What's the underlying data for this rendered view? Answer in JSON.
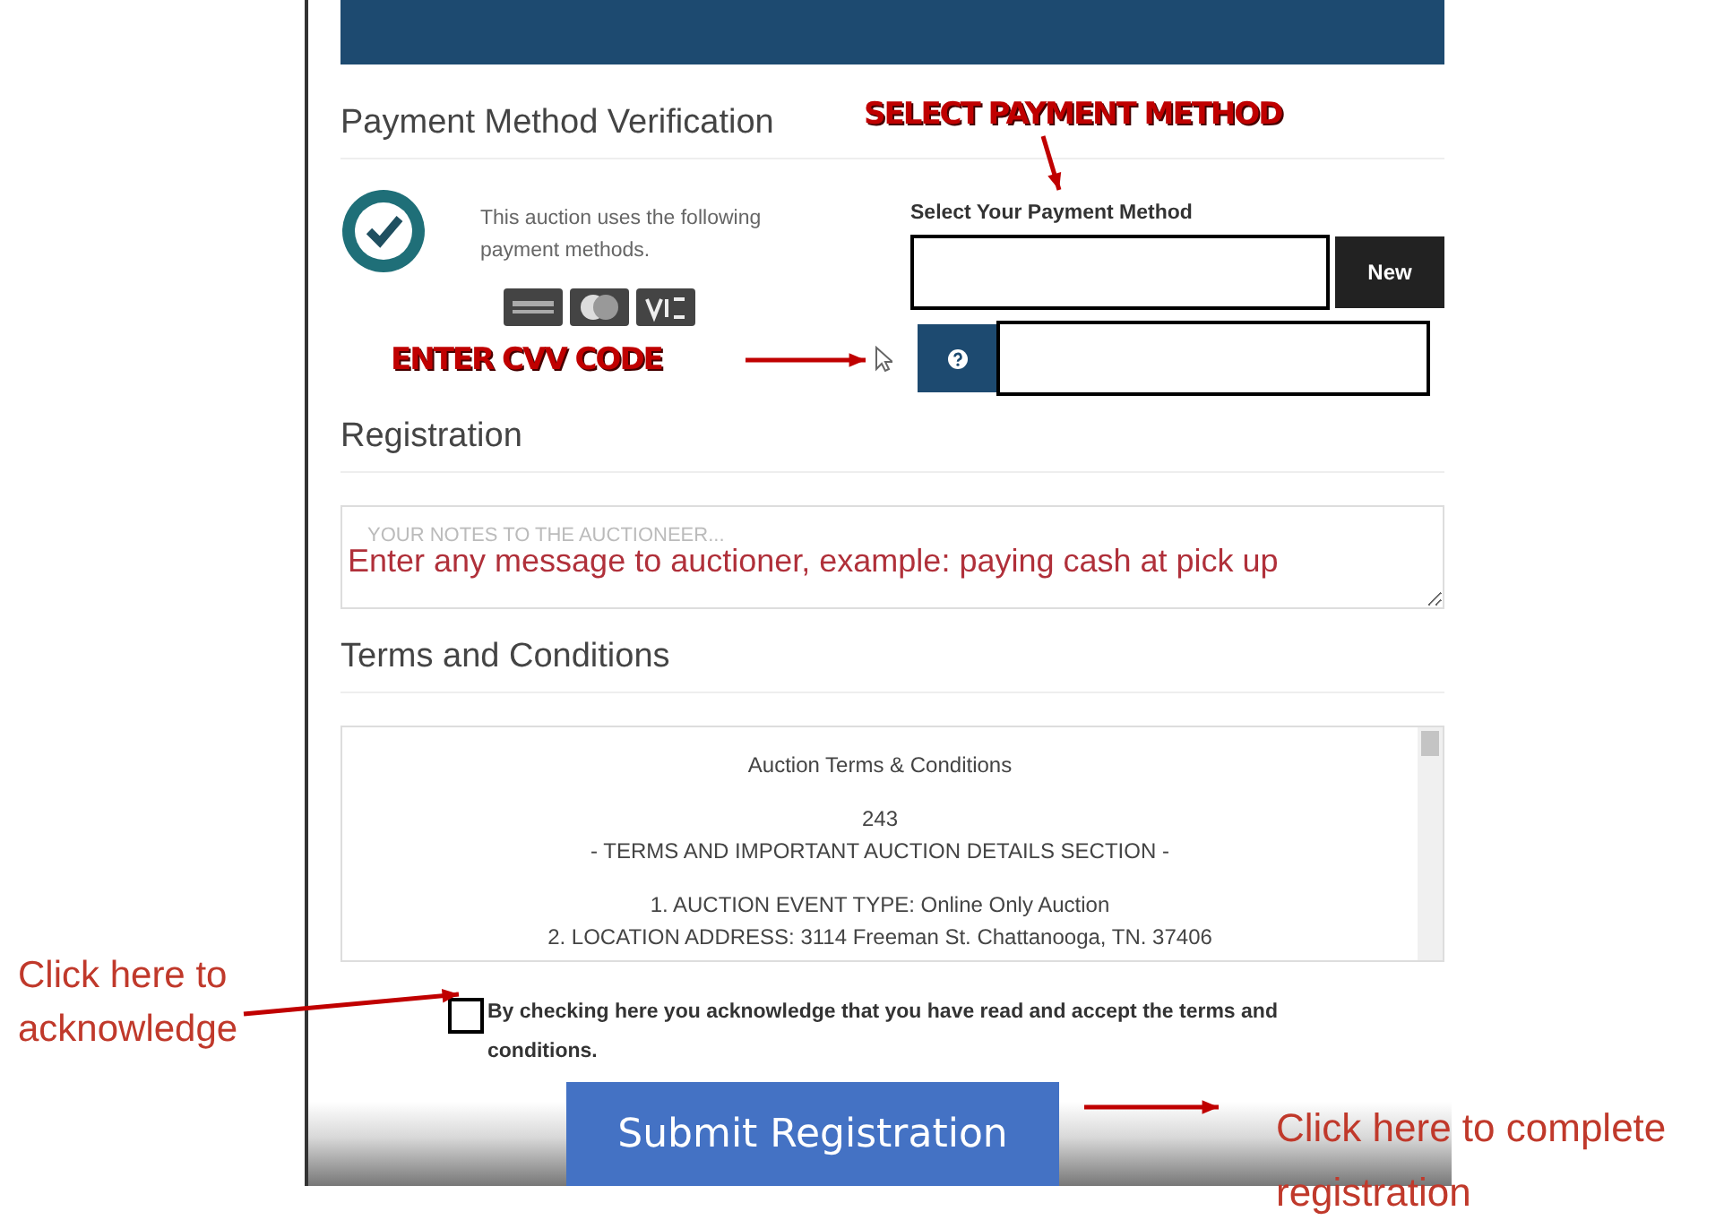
{
  "payment_section": {
    "title": "Payment Method Verification",
    "info_text": "This auction uses the following payment methods.",
    "method_label": "Select Your Payment Method",
    "new_button": "New"
  },
  "registration_section": {
    "title": "Registration",
    "notes_placeholder": "YOUR NOTES TO THE AUCTIONEER..."
  },
  "terms_section": {
    "title": "Terms and Conditions",
    "terms_blocks": [
      [
        "Auction Terms & Conditions"
      ],
      [
        "243",
        "- TERMS AND IMPORTANT AUCTION DETAILS SECTION -"
      ],
      [
        "1. AUCTION EVENT TYPE: Online Only Auction",
        "2. LOCATION ADDRESS: 3114 Freeman St. Chattanooga, TN. 37406"
      ]
    ],
    "acknowledge": {
      "label": "By checking here you acknowledge that you have read and accept the terms and conditions.",
      "checked": false
    }
  },
  "submit_button": "Submit Registration",
  "annotations": {
    "select_method": "SELECT PAYMENT METHOD",
    "cvv": "ENTER CVV CODE",
    "notes": "Enter any message to auctioner, example: paying cash at pick up",
    "acknowledge": "Click here to acknowledge",
    "complete": "Click here to complete registration"
  }
}
